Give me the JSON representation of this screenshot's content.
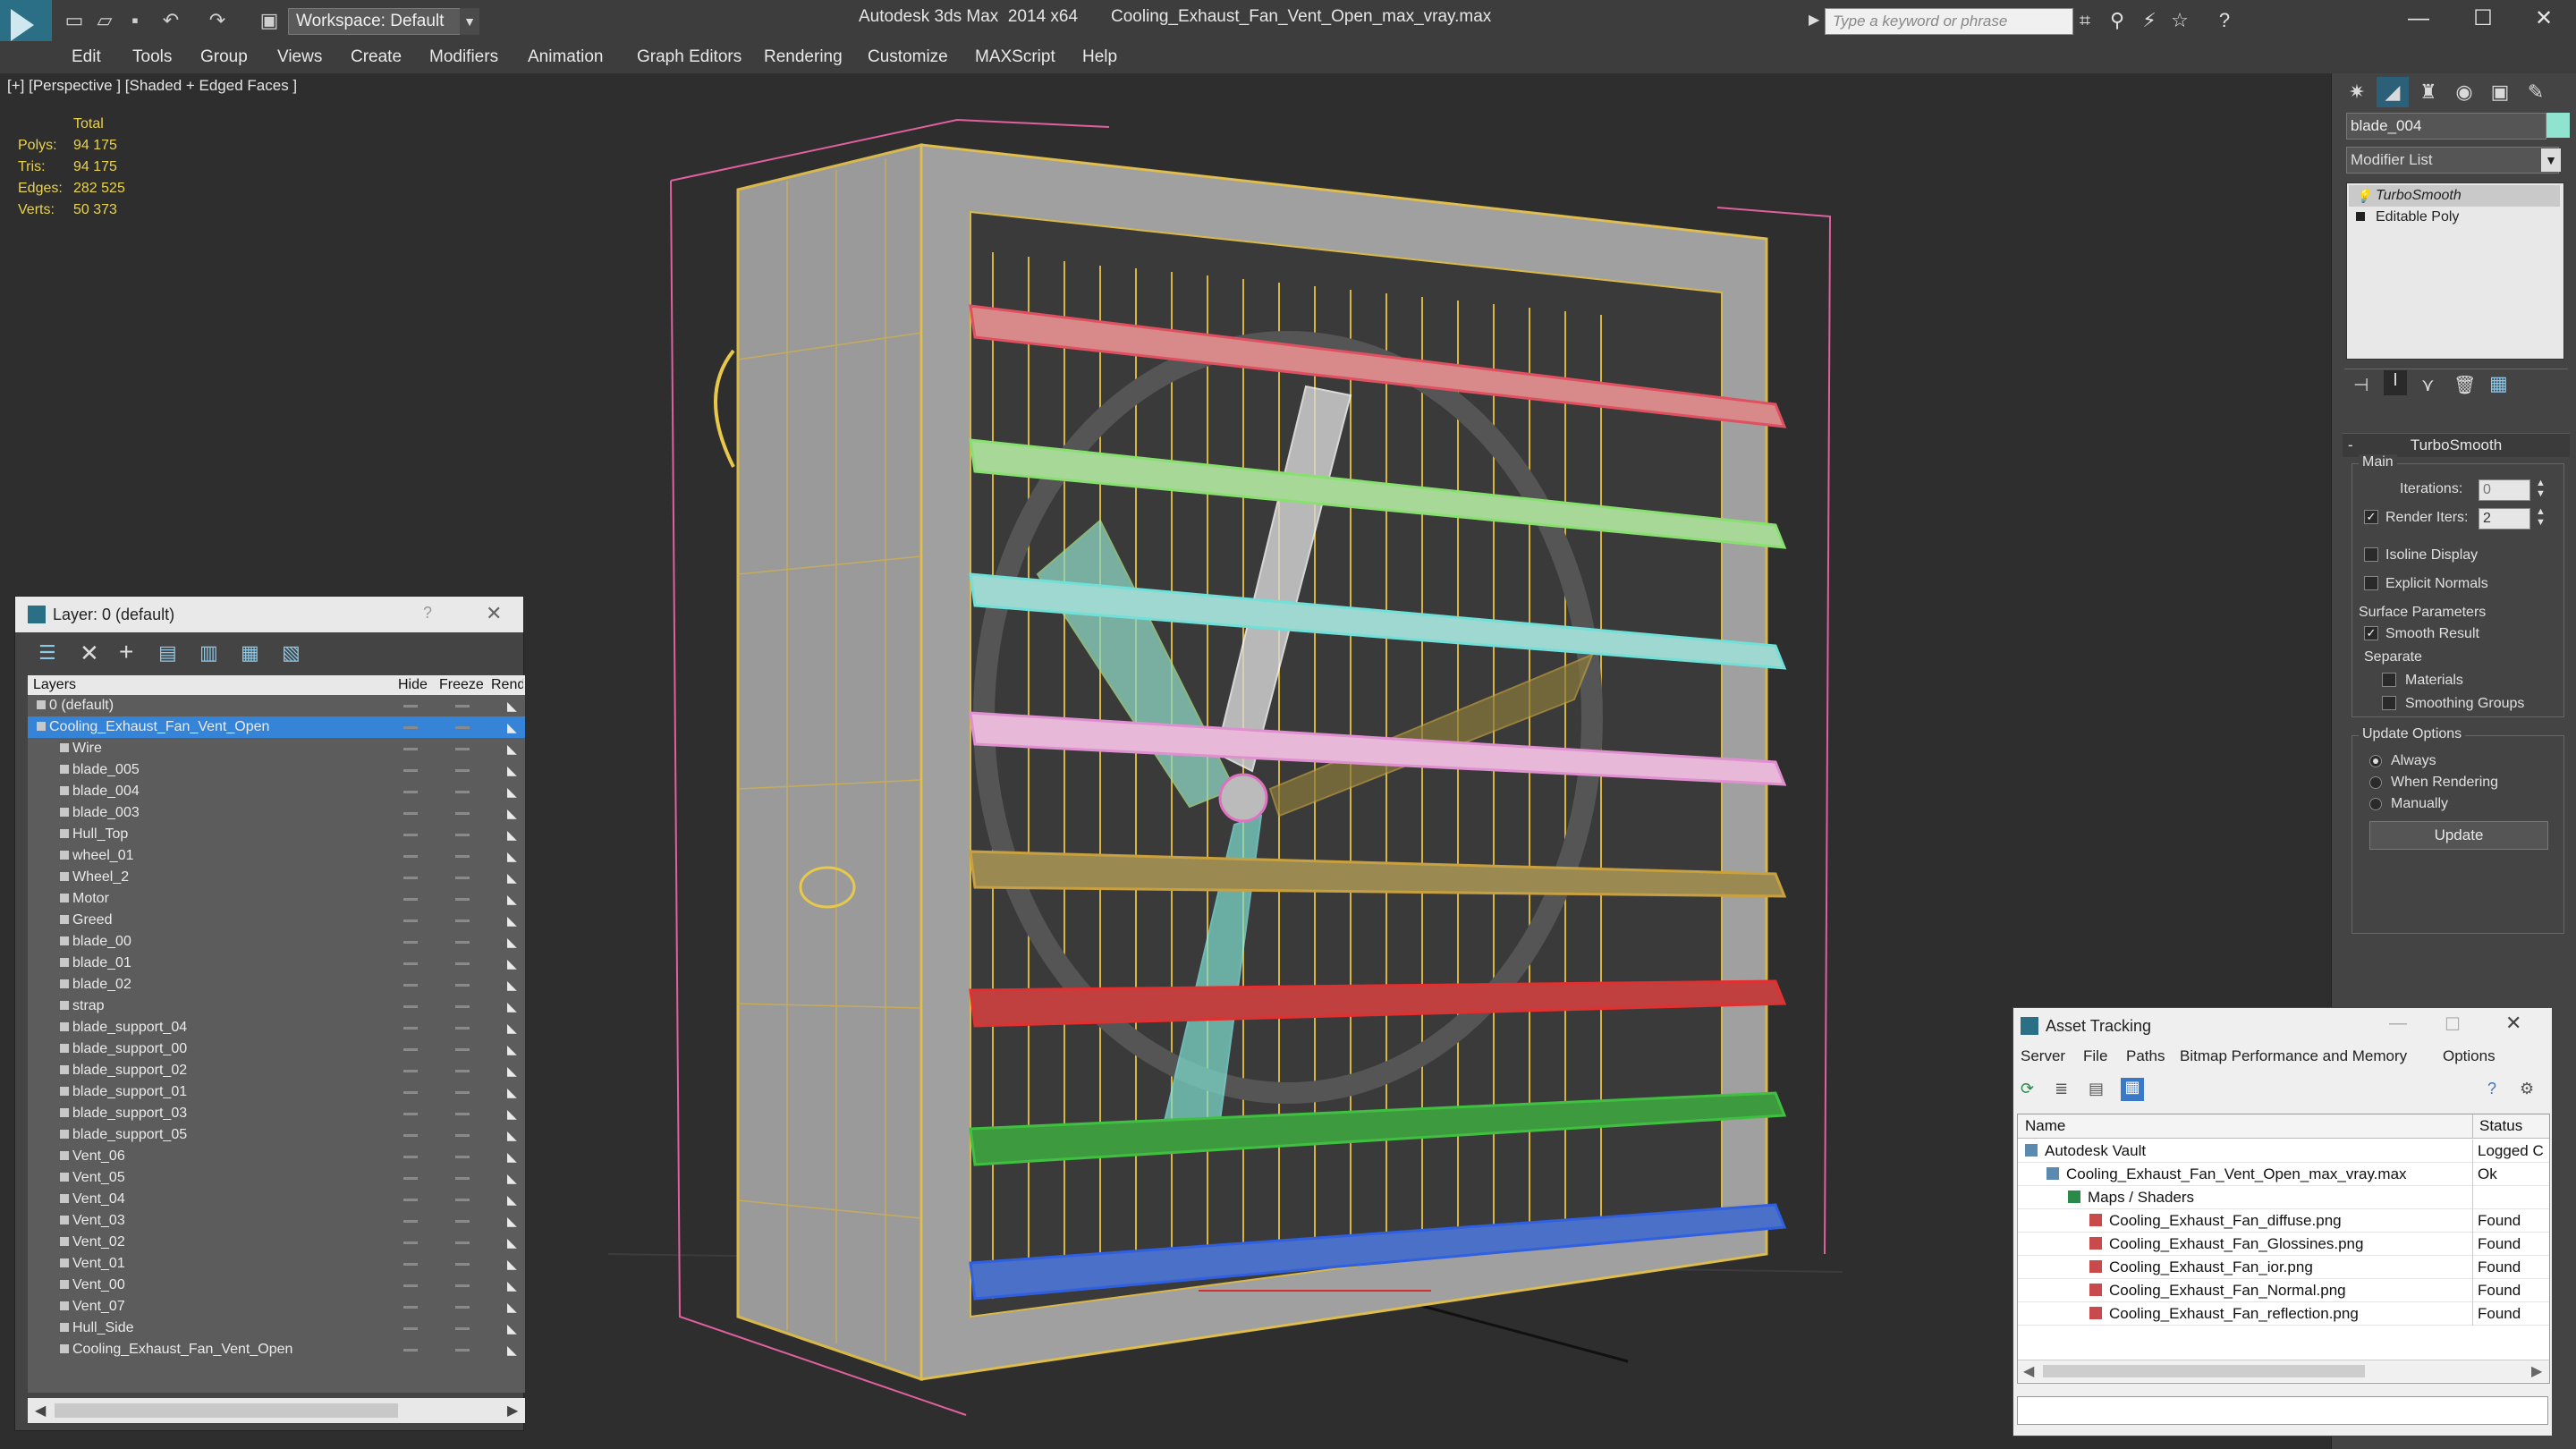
{
  "titlebar": {
    "workspace": "Workspace: Default",
    "title": "Autodesk 3ds Max  2014 x64       Cooling_Exhaust_Fan_Vent_Open_max_vray.max",
    "search_placeholder": "Type a keyword or phrase"
  },
  "menu": [
    "Edit",
    "Tools",
    "Group",
    "Views",
    "Create",
    "Modifiers",
    "Animation",
    "Graph Editors",
    "Rendering",
    "Customize",
    "MAXScript",
    "Help"
  ],
  "viewport": {
    "label": "[+] [Perspective ] [Shaded + Edged Faces ]",
    "stats_header": "Total",
    "stats": [
      {
        "label": "Polys:",
        "value": "94 175"
      },
      {
        "label": "Tris:",
        "value": "94 175"
      },
      {
        "label": "Edges:",
        "value": "282 525"
      },
      {
        "label": "Verts:",
        "value": "50 373"
      }
    ]
  },
  "layer_dialog": {
    "title": "Layer: 0 (default)",
    "help": "?",
    "columns": [
      "Layers",
      "Hide",
      "Freeze",
      "Rend"
    ],
    "layers": [
      {
        "name": "0 (default)",
        "level": 1
      },
      {
        "name": "Cooling_Exhaust_Fan_Vent_Open",
        "level": 1
      },
      {
        "name": "Wire",
        "level": 2
      },
      {
        "name": "blade_005",
        "level": 2
      },
      {
        "name": "blade_004",
        "level": 2
      },
      {
        "name": "blade_003",
        "level": 2
      },
      {
        "name": "Hull_Top",
        "level": 2
      },
      {
        "name": "wheel_01",
        "level": 2
      },
      {
        "name": "Wheel_2",
        "level": 2
      },
      {
        "name": "Motor",
        "level": 2
      },
      {
        "name": "Greed",
        "level": 2
      },
      {
        "name": "blade_00",
        "level": 2
      },
      {
        "name": "blade_01",
        "level": 2
      },
      {
        "name": "blade_02",
        "level": 2
      },
      {
        "name": "strap",
        "level": 2
      },
      {
        "name": "blade_support_04",
        "level": 2
      },
      {
        "name": "blade_support_00",
        "level": 2
      },
      {
        "name": "blade_support_02",
        "level": 2
      },
      {
        "name": "blade_support_01",
        "level": 2
      },
      {
        "name": "blade_support_03",
        "level": 2
      },
      {
        "name": "blade_support_05",
        "level": 2
      },
      {
        "name": "Vent_06",
        "level": 2
      },
      {
        "name": "Vent_05",
        "level": 2
      },
      {
        "name": "Vent_04",
        "level": 2
      },
      {
        "name": "Vent_03",
        "level": 2
      },
      {
        "name": "Vent_02",
        "level": 2
      },
      {
        "name": "Vent_01",
        "level": 2
      },
      {
        "name": "Vent_00",
        "level": 2
      },
      {
        "name": "Vent_07",
        "level": 2
      },
      {
        "name": "Hull_Side",
        "level": 2
      },
      {
        "name": "Cooling_Exhaust_Fan_Vent_Open",
        "level": 2
      }
    ]
  },
  "command_panel": {
    "object_name": "blade_004",
    "object_color": "#8fe3cf",
    "modifier_list": "Modifier List",
    "stack": [
      "TurboSmooth",
      "Editable Poly"
    ],
    "rollout_title": "TurboSmooth",
    "main_label": "Main",
    "iterations_label": "Iterations:",
    "iterations_value": "0",
    "render_iters_label": "Render Iters:",
    "render_iters_value": "2",
    "isoline_label": "Isoline Display",
    "explicit_label": "Explicit Normals",
    "surface_label": "Surface Parameters",
    "smooth_label": "Smooth Result",
    "separate_label": "Separate",
    "materials_label": "Materials",
    "smoothing_groups_label": "Smoothing Groups",
    "update_options_label": "Update Options",
    "always_label": "Always",
    "when_rendering_label": "When Rendering",
    "manually_label": "Manually",
    "update_button": "Update"
  },
  "asset_tracking": {
    "title": "Asset Tracking",
    "menu": [
      "Server",
      "File",
      "Paths",
      "Bitmap Performance and Memory",
      "Options"
    ],
    "columns": [
      "Name",
      "Status"
    ],
    "rows": [
      {
        "name": "Autodesk Vault",
        "status": "Logged C",
        "level": 0
      },
      {
        "name": "Cooling_Exhaust_Fan_Vent_Open_max_vray.max",
        "status": "Ok",
        "level": 1
      },
      {
        "name": "Maps / Shaders",
        "status": "",
        "level": 2
      },
      {
        "name": "Cooling_Exhaust_Fan_diffuse.png",
        "status": "Found",
        "level": 3
      },
      {
        "name": "Cooling_Exhaust_Fan_Glossines.png",
        "status": "Found",
        "level": 3
      },
      {
        "name": "Cooling_Exhaust_Fan_ior.png",
        "status": "Found",
        "level": 3
      },
      {
        "name": "Cooling_Exhaust_Fan_Normal.png",
        "status": "Found",
        "level": 3
      },
      {
        "name": "Cooling_Exhaust_Fan_reflection.png",
        "status": "Found",
        "level": 3
      }
    ]
  }
}
